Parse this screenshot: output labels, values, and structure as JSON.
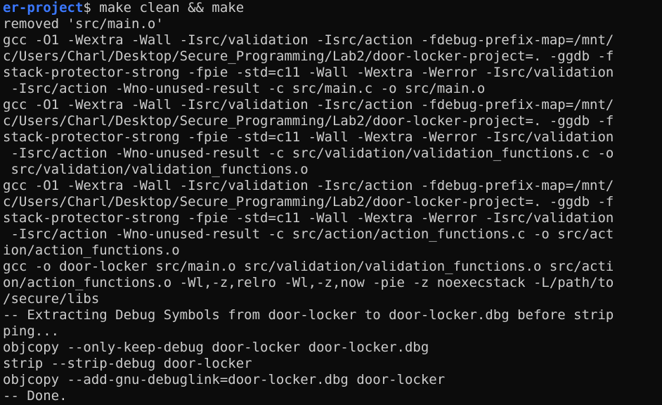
{
  "terminal": {
    "prompt": {
      "path": "er-project",
      "symbol": "$ ",
      "command": "make clean && make"
    },
    "lines": [
      "removed 'src/main.o'",
      "gcc -O1 -Wextra -Wall -Isrc/validation -Isrc/action -fdebug-prefix-map=/mnt/",
      "c/Users/Charl/Desktop/Secure_Programming/Lab2/door-locker-project=. -ggdb -f",
      "stack-protector-strong -fpie -std=c11 -Wall -Wextra -Werror -Isrc/validation",
      " -Isrc/action -Wno-unused-result -c src/main.c -o src/main.o",
      "gcc -O1 -Wextra -Wall -Isrc/validation -Isrc/action -fdebug-prefix-map=/mnt/",
      "c/Users/Charl/Desktop/Secure_Programming/Lab2/door-locker-project=. -ggdb -f",
      "stack-protector-strong -fpie -std=c11 -Wall -Wextra -Werror -Isrc/validation",
      " -Isrc/action -Wno-unused-result -c src/validation/validation_functions.c -o",
      " src/validation/validation_functions.o",
      "gcc -O1 -Wextra -Wall -Isrc/validation -Isrc/action -fdebug-prefix-map=/mnt/",
      "c/Users/Charl/Desktop/Secure_Programming/Lab2/door-locker-project=. -ggdb -f",
      "stack-protector-strong -fpie -std=c11 -Wall -Wextra -Werror -Isrc/validation",
      " -Isrc/action -Wno-unused-result -c src/action/action_functions.c -o src/act",
      "ion/action_functions.o",
      "gcc -o door-locker src/main.o src/validation/validation_functions.o src/acti",
      "on/action_functions.o -Wl,-z,relro -Wl,-z,now -pie -z noexecstack -L/path/to",
      "/secure/libs",
      "-- Extracting Debug Symbols from door-locker to door-locker.dbg before strip",
      "ping...",
      "objcopy --only-keep-debug door-locker door-locker.dbg",
      "strip --strip-debug door-locker",
      "objcopy --add-gnu-debuglink=door-locker.dbg door-locker",
      "-- Done."
    ]
  }
}
